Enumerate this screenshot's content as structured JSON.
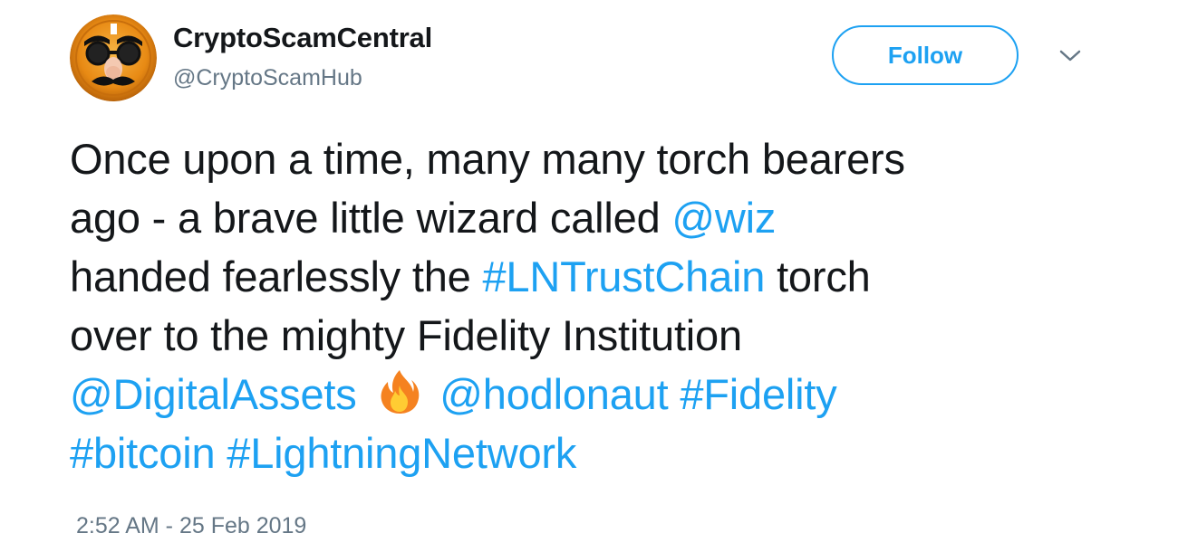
{
  "user": {
    "display_name": "CryptoScamCentral",
    "handle": "@CryptoScamHub",
    "avatar_icon": "disguise-glasses-avatar"
  },
  "follow_button": {
    "label": "Follow"
  },
  "menu_icon": "chevron-down-icon",
  "tweet": {
    "line1": "Once upon a time, many many torch bearers",
    "line2_text": "ago - a brave little wizard called ",
    "mention_wiz": "@wiz",
    "line3_pre": "handed fearlessly the ",
    "hashtag_lntrustchain": "#LNTrustChain",
    "line3_post": " torch",
    "line4": "over to the mighty Fidelity Institution",
    "mention_digitalassets": "@DigitalAssets",
    "emoji": "fire-emoji",
    "mention_hodlonaut": "@hodlonaut",
    "hashtag_fidelity": "#Fidelity",
    "hashtag_bitcoin": "#bitcoin",
    "hashtag_lightningnetwork": "#LightningNetwork"
  },
  "timestamp": "2:52 AM - 25 Feb 2019",
  "colors": {
    "link": "#1da1f2",
    "text": "#14171a",
    "muted": "#657786"
  }
}
